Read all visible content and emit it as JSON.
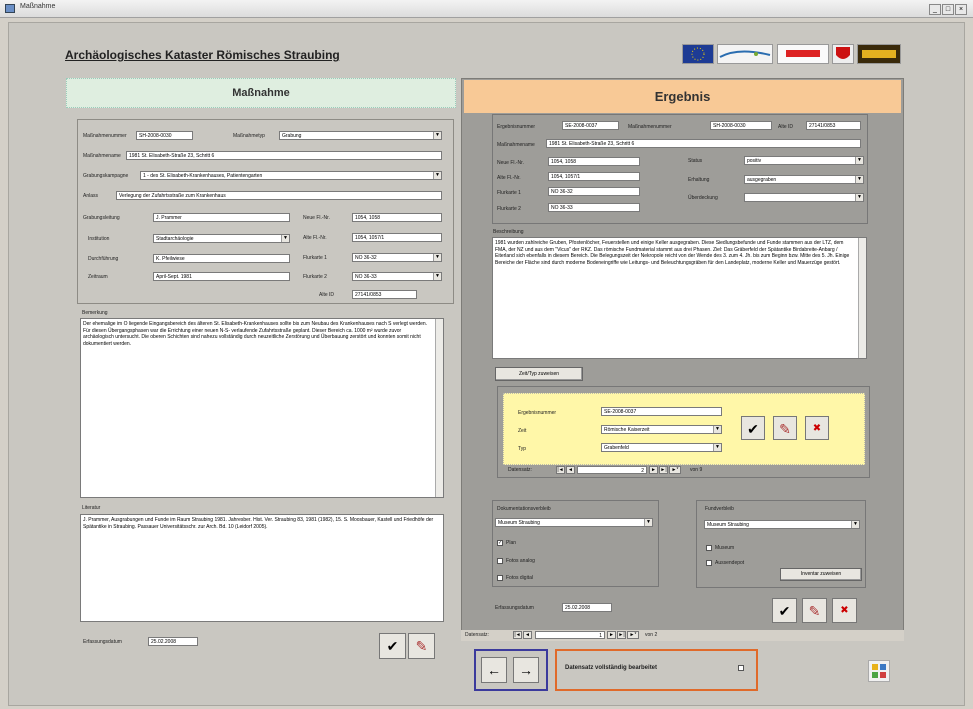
{
  "window": {
    "title": "Maßnahme",
    "controls": [
      "_",
      "□",
      "×"
    ]
  },
  "app_title": "Archäologisches Kataster Römisches Straubing",
  "left": {
    "header": "Maßnahme",
    "massnahmenummer": {
      "label": "Maßnahmenummer",
      "value": "SH-2008-0030"
    },
    "massnahmetyp": {
      "label": "Maßnahmetyp",
      "value": "Grabung"
    },
    "massnahmename": {
      "label": "Maßnahmename",
      "value": "1981 St. Elisabeth-Straße 23, Schritt 6"
    },
    "grabungskampagne": {
      "label": "Grabungskampagne",
      "value": "1 - des St. Elisabeth-Krankenhauses, Patientengarten"
    },
    "anlass": {
      "label": "Anlass",
      "value": "Verlegung der Zufahrtsstraße zum Krankenhaus"
    },
    "grabungsleitung": {
      "label": "Grabungsleitung",
      "value": "J. Prammer"
    },
    "institution": {
      "label": "Institution",
      "value": "Stadtarchäologie"
    },
    "durchfuehrung": {
      "label": "Durchführung",
      "value": "K. Pfeilwiese"
    },
    "zeitraum": {
      "label": "Zeitraum",
      "value": "April-Sept. 1981"
    },
    "neue_flnr": {
      "label": "Neue Fl.-Nr.",
      "value": "1054, 1058"
    },
    "alte_flnr": {
      "label": "Alte Fl.-Nr.",
      "value": "1054, 1057/1"
    },
    "flurkarte1": {
      "label": "Flurkarte 1",
      "value": "NO 36-32"
    },
    "flurkarte2": {
      "label": "Flurkarte 2",
      "value": "NO 36-33"
    },
    "alte_id": {
      "label": "Alte ID",
      "value": "27141/0853"
    },
    "bemerkung_label": "Bemerkung",
    "bemerkung": "Der ehemalige im O liegende Eingangsbereich des älteren St. Elisabeth-Krankenhauses sollte bis zum Neubau des Krankenhauses nach S verlegt werden. Für diesen Übergangsphasen war die Errichtung einer neuen N-S- verlaufende Zufahrtsstraße geplant. Dieser Bereich ca. 1000 m² wurde zuvor archäologisch untersucht. Die oberen Schichten sind nahezu vollständig durch neuzeitliche Zerstörung und Überbauung zerstört und konnten somit nicht dokumentiert werden.",
    "literatur_label": "Literatur",
    "literatur": "J. Prammer, Ausgrabungen und Funde im Raum Straubing 1981. Jahresber. Hist. Ver. Straubing 83, 1981 (1982), 15. S. Moosbauer, Kastell und Friedhöfe der Spätantike in Straubing. Passauer Universitätsschr. zur Arch. Bd. 10 (Leidorf 2005).",
    "erfassungsdatum": {
      "label": "Erfassungsdatum",
      "value": "25.02.2008"
    }
  },
  "right": {
    "header": "Ergebnis",
    "ergebnisnummer": {
      "label": "Ergebnisnummer",
      "value": "SE-2008-0037"
    },
    "massnahmenummer": {
      "label": "Maßnahmenummer",
      "value": "SH-2008-0030"
    },
    "alte_id": {
      "label": "Alte ID",
      "value": "27141/0853"
    },
    "massnahmename": {
      "label": "Maßnahmename",
      "value": "1981 St. Elisabeth-Straße 23, Schritt 6"
    },
    "neue_flnr": {
      "label": "Neue Fl.-Nr.",
      "value": "1054, 1058"
    },
    "alte_flnr": {
      "label": "Alte Fl.-Nr.",
      "value": "1054, 1057/1"
    },
    "flurkarte1": {
      "label": "Flurkarte 1",
      "value": "NO 36-32"
    },
    "flurkarte2": {
      "label": "Flurkarte 2",
      "value": "NO 36-33"
    },
    "status": {
      "label": "Status",
      "value": "positiv"
    },
    "erhaltung": {
      "label": "Erhaltung",
      "value": "ausgegraben"
    },
    "ueberdeckung": {
      "label": "Überdeckung",
      "value": ""
    },
    "beschreibung_label": "Beschreibung",
    "beschreibung": "1981 wurden zahlreiche Gruben, Pfostenlöcher, Feuerstellen und einige Keller ausgegraben. Diese Siedlungsbefunde und Funde stammen aus der LTZ, dem FMA, der NZ und aus dem \"Vicus\" der RKZ. Das römische Fundmaterial stammt aus drei Phasen. Ziel: Das Gräberfeld der Spätantike Birdabreite-Anbarg / Eiterland sich ebenfalls in diesem Bereich. Die Belegungszeit der Nekropole reicht von der Wende des 3. zum 4. Jh. bis zum Beginn bzw. Mitte des 5. Jh. Einige Bereiche der Fläche sind durch moderne Bodeneingriffe wie Leitungs- und Beleuchtungsgräben für den Landeplatz, moderne Keller und Mauerzüge gestört.",
    "zeit_typ_button": "Zeit/Typ zuweisen",
    "sub_ergebnisnummer": {
      "label": "Ergebnisnummer",
      "value": "SE-2008-0037"
    },
    "sub_zeit": {
      "label": "Zeit",
      "value": "Römische Kaiserzeit"
    },
    "sub_typ": {
      "label": "Typ",
      "value": "Grabenfeld"
    },
    "sub_nav": {
      "label": "Datensatz:",
      "current": "2",
      "total": "von 9"
    },
    "doku": {
      "label": "Dokumentationsverbleib",
      "value": "Museum Straubing",
      "plan": "Plan",
      "foto_analog": "Fotos analog",
      "foto_digital": "Fotos digital",
      "plan_checked": "✓"
    },
    "fund": {
      "label": "Fundverbleib",
      "value": "Museum Straubing",
      "museum": "Museum",
      "aussendepot": "Aussendepot",
      "inventar_button": "Inventar zuweisen"
    },
    "erfassungsdatum": {
      "label": "Erfassungsdatum",
      "value": "25.02.2008"
    },
    "main_nav": {
      "label": "Datensatz:",
      "current": "1",
      "total": "von 2"
    }
  },
  "bottom": {
    "prev": "←",
    "next": "→",
    "complete_label": "Datensatz vollständig bearbeitet"
  },
  "icons": {
    "save": "✔",
    "edit": "✎",
    "delete": "✖"
  }
}
